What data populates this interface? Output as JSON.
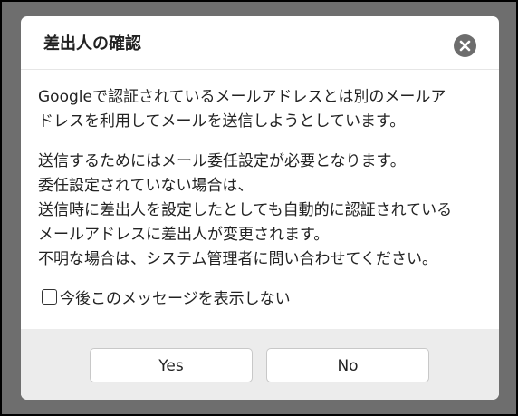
{
  "dialog": {
    "title": "差出人の確認",
    "close_icon": "close-icon",
    "paragraphs": [
      [
        "Googleで認証されているメールアドレスとは別のメールア",
        "ドレスを利用してメールを送信しようとしています。"
      ],
      [
        "送信するためにはメール委任設定が必要となります。",
        "委任設定されていない場合は、",
        "送信時に差出人を設定したとしても自動的に認証されている",
        "メールアドレスに差出人が変更されます。",
        "不明な場合は、システム管理者に問い合わせてください。"
      ]
    ],
    "checkbox": {
      "label": "今後このメッセージを表示しない",
      "checked": false
    },
    "buttons": {
      "yes": "Yes",
      "no": "No"
    }
  },
  "colors": {
    "backdrop": "#6e6e6e",
    "footer": "#ececec",
    "close_button": "#6d6d6d"
  }
}
